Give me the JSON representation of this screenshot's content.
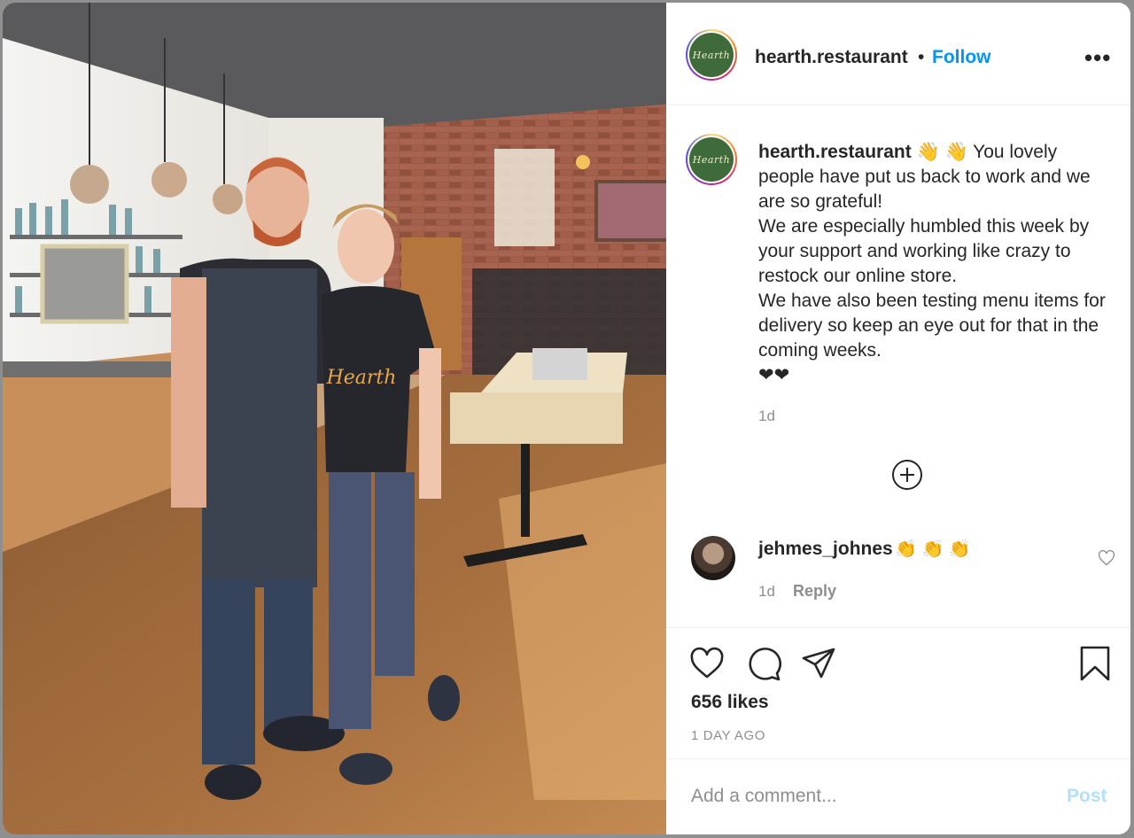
{
  "post": {
    "username": "hearth.restaurant",
    "follow_label": "Follow",
    "separator": "•",
    "more_label": "•••",
    "avatar_text": "Hearth",
    "photo_shirt_text": "Hearth"
  },
  "caption": {
    "username": "hearth.restaurant",
    "text": "👋 👋  You lovely people have put us back to work and we are so grateful!\nWe are especially humbled this week by your support and working like crazy to restock our online store.\nWe have also been testing menu items for delivery so keep an eye out for that in the coming weeks.\n❤❤",
    "time": "1d"
  },
  "comments": [
    {
      "username": "jehmes_johnes",
      "text": "👏 👏 👏",
      "time": "1d",
      "reply_label": "Reply"
    }
  ],
  "actions": {
    "like_icon": "heart-icon",
    "comment_icon": "comment-icon",
    "share_icon": "share-icon",
    "save_icon": "bookmark-icon"
  },
  "stats": {
    "likes": "656 likes",
    "posted_ago": "1 DAY AGO"
  },
  "comment_box": {
    "placeholder": "Add a comment...",
    "value": "",
    "post_label": "Post"
  },
  "colors": {
    "link": "#0095f6",
    "post_disabled": "#b2dffc",
    "secondary_text": "#8e8e8e",
    "logo_green": "#3f6b3a"
  }
}
